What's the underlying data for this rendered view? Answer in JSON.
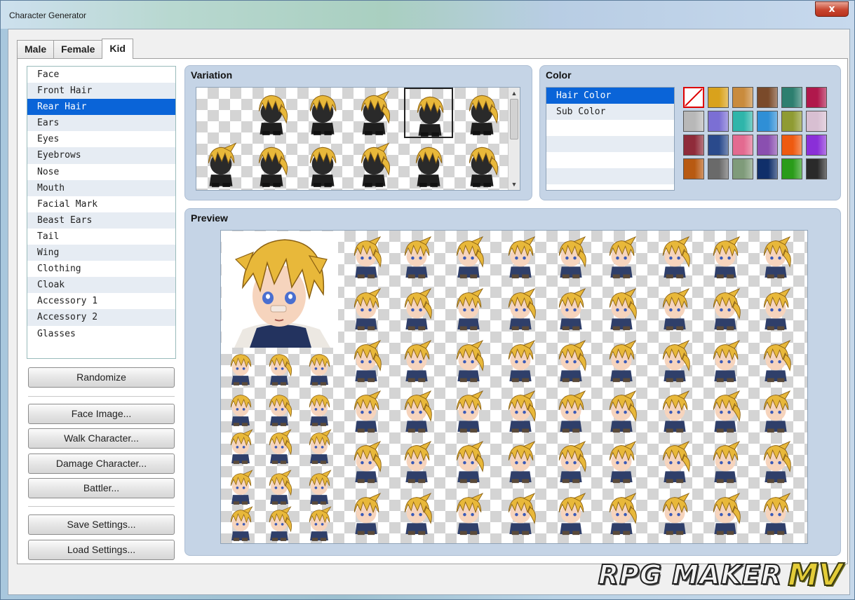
{
  "window": {
    "title": "Character Generator",
    "close_glyph": "x"
  },
  "tabs": [
    {
      "label": "Male",
      "active": false
    },
    {
      "label": "Female",
      "active": false
    },
    {
      "label": "Kid",
      "active": true
    }
  ],
  "parts": {
    "items": [
      "Face",
      "Front Hair",
      "Rear Hair",
      "Ears",
      "Eyes",
      "Eyebrows",
      "Nose",
      "Mouth",
      "Facial Mark",
      "Beast Ears",
      "Tail",
      "Wing",
      "Clothing",
      "Cloak",
      "Accessory 1",
      "Accessory 2",
      "Glasses"
    ],
    "selected": "Rear Hair"
  },
  "buttons": {
    "randomize": "Randomize",
    "face_image": "Face Image...",
    "walk_character": "Walk Character...",
    "damage_character": "Damage Character...",
    "battler": "Battler...",
    "save_settings": "Save Settings...",
    "load_settings": "Load Settings..."
  },
  "variation": {
    "title": "Variation",
    "cell_count": 12,
    "selected_index": 4,
    "scroll_up_icon": "scroll-up-arrow",
    "scroll_down_icon": "scroll-down-arrow"
  },
  "color": {
    "title": "Color",
    "items": [
      "Hair Color",
      "Sub Color",
      "",
      "",
      "",
      ""
    ],
    "selected": "Hair Color",
    "swatches": [
      "none",
      "#d9a21c",
      "#c98b3d",
      "#7a4a2a",
      "#2d7f6f",
      "#b0184c",
      "#b8b8b8",
      "#7b6fd4",
      "#2fb5aa",
      "#2f8fd6",
      "#8f9b33",
      "#d8bfd2",
      "#8f2b3a",
      "#2a4a8c",
      "#e36a90",
      "#8a4fb0",
      "#ee5a10",
      "#8a2fd8",
      "#b85a12",
      "#6a6a6a",
      "#7f9b7a",
      "#102f6a",
      "#2a9c1a",
      "#2a2a2a"
    ]
  },
  "preview": {
    "title": "Preview",
    "hair_color": "#e8b83a",
    "outfit_color": "#2f3f6a"
  },
  "logo": {
    "main": "RPG MAKER",
    "suffix": "MV"
  }
}
